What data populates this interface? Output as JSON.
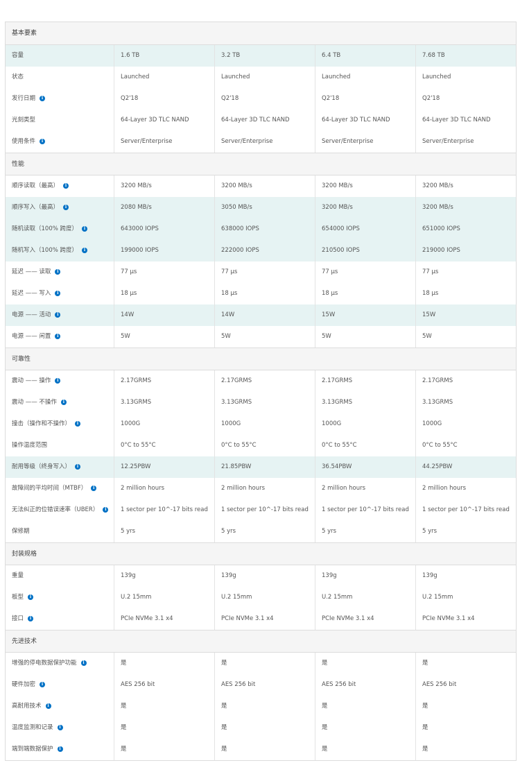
{
  "sections": [
    {
      "title": "基本要素",
      "rows": [
        {
          "label": "容量",
          "info": false,
          "hl": true,
          "values": [
            "1.6 TB",
            "3.2 TB",
            "6.4 TB",
            "7.68 TB"
          ]
        },
        {
          "label": "状态",
          "info": false,
          "hl": false,
          "values": [
            "Launched",
            "Launched",
            "Launched",
            "Launched"
          ]
        },
        {
          "label": "发行日期",
          "info": true,
          "hl": false,
          "values": [
            "Q2'18",
            "Q2'18",
            "Q2'18",
            "Q2'18"
          ]
        },
        {
          "label": "光刻类型",
          "info": false,
          "hl": false,
          "values": [
            "64-Layer 3D TLC NAND",
            "64-Layer 3D TLC NAND",
            "64-Layer 3D TLC NAND",
            "64-Layer 3D TLC NAND"
          ]
        },
        {
          "label": "使用条件",
          "info": true,
          "hl": false,
          "values": [
            "Server/Enterprise",
            "Server/Enterprise",
            "Server/Enterprise",
            "Server/Enterprise"
          ]
        }
      ]
    },
    {
      "title": "性能",
      "rows": [
        {
          "label": "顺序读取（最高）",
          "info": true,
          "hl": false,
          "values": [
            "3200 MB/s",
            "3200 MB/s",
            "3200 MB/s",
            "3200 MB/s"
          ]
        },
        {
          "label": "顺序写入（最高）",
          "info": true,
          "hl": true,
          "values": [
            "2080 MB/s",
            "3050 MB/s",
            "3200 MB/s",
            "3200 MB/s"
          ]
        },
        {
          "label": "随机读取（100% 跨度）",
          "info": true,
          "hl": true,
          "values": [
            "643000 IOPS",
            "638000 IOPS",
            "654000 IOPS",
            "651000 IOPS"
          ]
        },
        {
          "label": "随机写入（100% 跨度）",
          "info": true,
          "hl": true,
          "values": [
            "199000 IOPS",
            "222000 IOPS",
            "210500 IOPS",
            "219000 IOPS"
          ]
        },
        {
          "label": "延迟 —— 读取",
          "info": true,
          "hl": false,
          "values": [
            "77 µs",
            "77 µs",
            "77 µs",
            "77 µs"
          ]
        },
        {
          "label": "延迟 —— 写入",
          "info": true,
          "hl": false,
          "values": [
            "18 µs",
            "18 µs",
            "18 µs",
            "18 µs"
          ]
        },
        {
          "label": "电源 —— 活动",
          "info": true,
          "hl": true,
          "values": [
            "14W",
            "14W",
            "15W",
            "15W"
          ]
        },
        {
          "label": "电源 —— 闲置",
          "info": true,
          "hl": false,
          "values": [
            "5W",
            "5W",
            "5W",
            "5W"
          ]
        }
      ]
    },
    {
      "title": "可靠性",
      "rows": [
        {
          "label": "震动 —— 操作",
          "info": true,
          "hl": false,
          "values": [
            "2.17GRMS",
            "2.17GRMS",
            "2.17GRMS",
            "2.17GRMS"
          ]
        },
        {
          "label": "震动 —— 不操作",
          "info": true,
          "hl": false,
          "values": [
            "3.13GRMS",
            "3.13GRMS",
            "3.13GRMS",
            "3.13GRMS"
          ]
        },
        {
          "label": "撞击（操作和不操作）",
          "info": true,
          "hl": false,
          "values": [
            "1000G",
            "1000G",
            "1000G",
            "1000G"
          ]
        },
        {
          "label": "操作温度范围",
          "info": false,
          "hl": false,
          "values": [
            "0°C to 55°C",
            "0°C to 55°C",
            "0°C to 55°C",
            "0°C to 55°C"
          ]
        },
        {
          "label": "耐用等级（终身写入）",
          "info": true,
          "hl": true,
          "values": [
            "12.25PBW",
            "21.85PBW",
            "36.54PBW",
            "44.25PBW"
          ]
        },
        {
          "label": "故障间的平均时间（MTBF）",
          "info": true,
          "hl": false,
          "values": [
            "2 million hours",
            "2 million hours",
            "2 million hours",
            "2 million hours"
          ]
        },
        {
          "label": "无法纠正的位错误速率（UBER）",
          "info": true,
          "hl": false,
          "values": [
            "1 sector per 10^-17 bits read",
            "1 sector per 10^-17 bits read",
            "1 sector per 10^-17 bits read",
            "1 sector per 10^-17 bits read"
          ]
        },
        {
          "label": "保修期",
          "info": false,
          "hl": false,
          "values": [
            "5 yrs",
            "5 yrs",
            "5 yrs",
            "5 yrs"
          ]
        }
      ]
    },
    {
      "title": "封装规格",
      "rows": [
        {
          "label": "重量",
          "info": false,
          "hl": false,
          "values": [
            "139g",
            "139g",
            "139g",
            "139g"
          ]
        },
        {
          "label": "板型",
          "info": true,
          "hl": false,
          "values": [
            "U.2 15mm",
            "U.2 15mm",
            "U.2 15mm",
            "U.2 15mm"
          ]
        },
        {
          "label": "接口",
          "info": true,
          "hl": false,
          "values": [
            "PCIe NVMe 3.1 x4",
            "PCIe NVMe 3.1 x4",
            "PCIe NVMe 3.1 x4",
            "PCIe NVMe 3.1 x4"
          ]
        }
      ]
    },
    {
      "title": "先进技术",
      "rows": [
        {
          "label": "增强的停电数据保护功能",
          "info": true,
          "hl": false,
          "values": [
            "是",
            "是",
            "是",
            "是"
          ]
        },
        {
          "label": "硬件加密",
          "info": true,
          "hl": false,
          "values": [
            "AES 256 bit",
            "AES 256 bit",
            "AES 256 bit",
            "AES 256 bit"
          ]
        },
        {
          "label": "高耐用技术",
          "info": true,
          "hl": false,
          "values": [
            "是",
            "是",
            "是",
            "是"
          ]
        },
        {
          "label": "温度监测和记录",
          "info": true,
          "hl": false,
          "values": [
            "是",
            "是",
            "是",
            "是"
          ]
        },
        {
          "label": "端到端数据保护",
          "info": true,
          "hl": false,
          "values": [
            "是",
            "是",
            "是",
            "是"
          ]
        }
      ]
    }
  ],
  "info_icon_glyph": "i",
  "colors": {
    "highlight_row": "#e6f3f3",
    "info_icon": "#0071c5",
    "section_bg": "#f5f5f5"
  }
}
